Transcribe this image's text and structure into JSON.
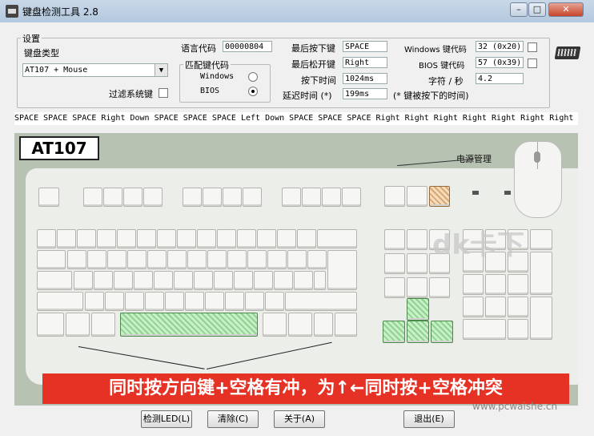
{
  "window": {
    "title": "键盘检测工具 2.8"
  },
  "settings": {
    "group_title": "设置",
    "kb_type_label": "键盘类型",
    "kb_type_value": "AT107 + Mouse",
    "filter_label": "过滤系统键",
    "lang_label": "语言代码",
    "lang_value": "00000804",
    "match_title": "匹配键代码",
    "match_windows": "Windows",
    "match_bios": "BIOS",
    "last_down_label": "最后按下键",
    "last_down_value": "SPACE",
    "last_up_label": "最后松开键",
    "last_up_value": "Right",
    "press_time_label": "按下时间",
    "press_time_value": "1024ms",
    "delay_label": "延迟时间 (*)",
    "delay_value": "199ms",
    "delay_note": "(* 键被按下的时间)",
    "win_code_label": "Windows 键代码",
    "win_code_value": "32 (0x20)",
    "bios_code_label": "BIOS 键代码",
    "bios_code_value": "57 (0x39)",
    "cps_label": "字符 / 秒",
    "cps_value": "4.2"
  },
  "log": "SPACE SPACE SPACE Right Down SPACE SPACE SPACE Left Down SPACE SPACE SPACE Right Right Right Right Right Right Right",
  "keyboard": {
    "badge": "AT107",
    "power_label": "电源管理",
    "banner": "同时按方向键+空格有冲，为↑←同时按+空格冲突",
    "watermark": "dk卡下",
    "watermark_url": "www.pcwaishe.cn"
  },
  "buttons": {
    "led": "检测LED(L)",
    "clear": "清除(C)",
    "about": "关于(A)",
    "exit": "退出(E)"
  },
  "colors": {
    "highlight": "#8fd28f",
    "banner": "#e63224"
  }
}
